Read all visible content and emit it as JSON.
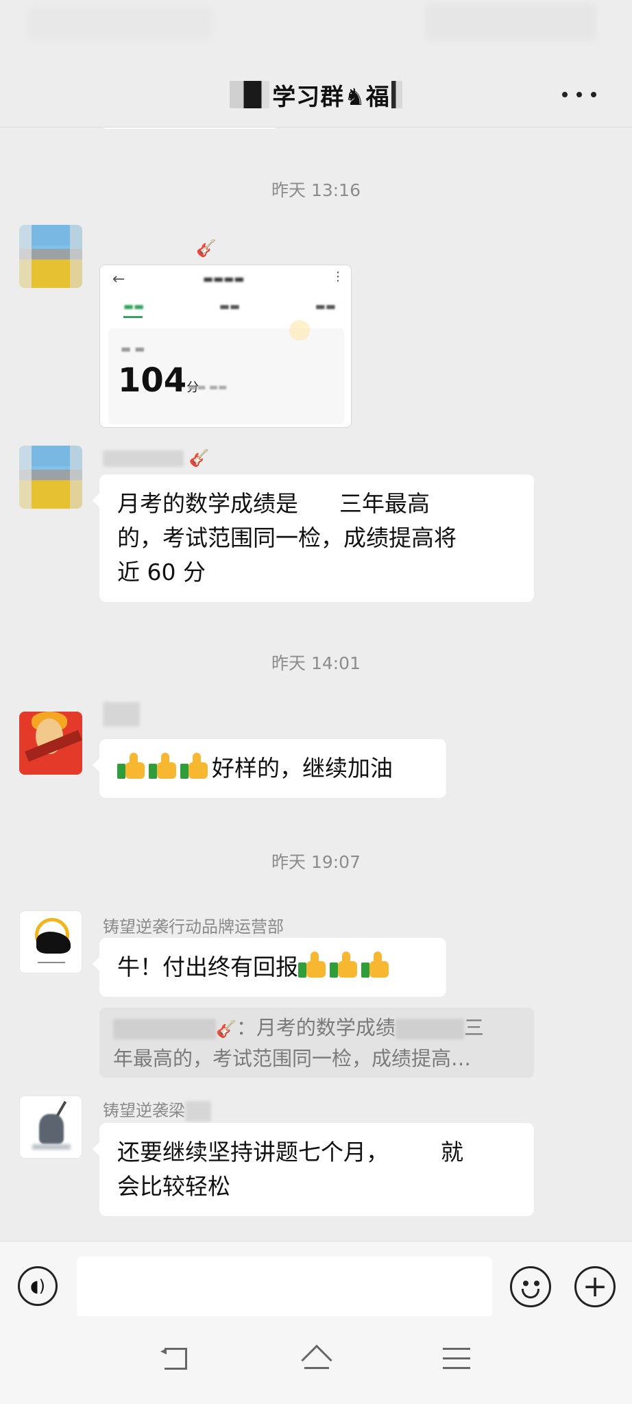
{
  "header": {
    "title": "学习群♞福"
  },
  "timestamps": [
    "昨天 13:16",
    "昨天 14:01",
    "昨天 19:07"
  ],
  "image_message": {
    "score": "104",
    "score_unit": "分"
  },
  "messages": [
    {
      "sender_suffix": "🎸",
      "lines": [
        "月考的数学成绩是",
        "三年最高",
        "的，考试范围同一检，成绩提高将",
        "近 60 分"
      ]
    },
    {
      "text": "好样的，继续加油"
    },
    {
      "sender": "铸望逆袭行动品牌运营部",
      "text": "牛！付出终有回报"
    },
    {
      "sender": "铸望逆袭梁",
      "lines": [
        "还要继续坚持讲题七个月，",
        "就",
        "会比较轻松"
      ]
    }
  ],
  "quote": {
    "line1_a": "：月考的数学成绩",
    "line1_b": "三",
    "line2": "年最高的，考试范围同一检，成绩提高…"
  },
  "icons": {
    "more": "more-icon",
    "voice": "voice-icon",
    "emoji": "emoji-icon",
    "plus": "plus-icon",
    "thumb": "thumbs-up-icon",
    "guitar": "guitar-icon"
  }
}
